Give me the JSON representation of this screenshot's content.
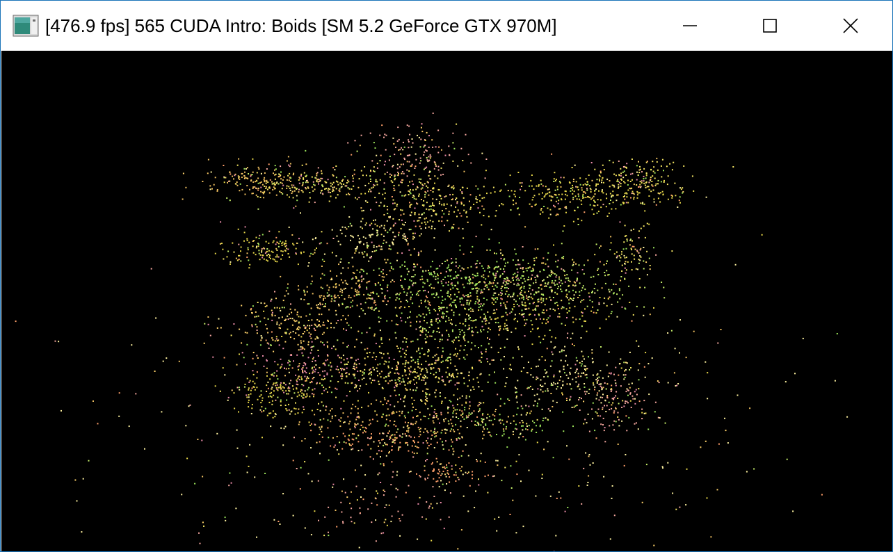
{
  "window": {
    "title": "[476.9 fps] 565 CUDA Intro: Boids [SM 5.2 GeForce GTX 970M]",
    "icon": "app-window-icon",
    "controls": {
      "minimize_icon": "minimize-icon",
      "maximize_icon": "maximize-icon",
      "close_icon": "close-icon"
    }
  },
  "viewport": {
    "background": "#000000",
    "particle_palette": [
      "#f5e663",
      "#e8d84a",
      "#f0c060",
      "#f7a8a0",
      "#9be35a",
      "#e88aa8",
      "#ffd36b",
      "#c6f06a",
      "#ff9f6a",
      "#fff3a0"
    ]
  }
}
